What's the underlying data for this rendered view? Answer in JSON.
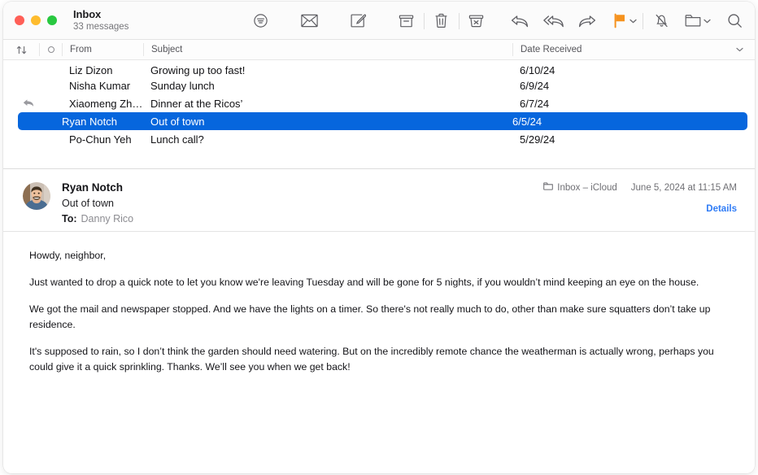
{
  "window": {
    "traffic_lights": [
      {
        "name": "close",
        "color": "#ff5f57"
      },
      {
        "name": "minimize",
        "color": "#febc2e"
      },
      {
        "name": "zoom",
        "color": "#28c840"
      }
    ]
  },
  "header": {
    "title": "Inbox",
    "subtitle": "33 messages"
  },
  "toolbar": {
    "items": [
      {
        "name": "filter-icon",
        "label": "Filter"
      },
      {
        "name": "mark-read-icon",
        "label": "Mark as Read"
      },
      {
        "name": "compose-icon",
        "label": "New Message"
      },
      {
        "name": "archive-icon",
        "label": "Archive"
      },
      {
        "name": "trash-icon",
        "label": "Delete"
      },
      {
        "name": "junk-icon",
        "label": "Move to Junk"
      },
      {
        "name": "reply-icon",
        "label": "Reply"
      },
      {
        "name": "reply-all-icon",
        "label": "Reply All"
      },
      {
        "name": "forward-icon",
        "label": "Forward"
      },
      {
        "name": "flag-icon",
        "label": "Flag"
      },
      {
        "name": "mute-icon",
        "label": "Mute"
      },
      {
        "name": "move-folder-icon",
        "label": "Move to Folder"
      },
      {
        "name": "search-icon",
        "label": "Search"
      }
    ],
    "flag_color": "#f5921e"
  },
  "list": {
    "columns": {
      "sort": "sort-icon",
      "unread": "unread-circle",
      "from": "From",
      "subject": "Subject",
      "date": "Date Received"
    },
    "rows": [
      {
        "from": "Liz Dizon",
        "subject": "Growing up too fast!",
        "date": "6/10/24",
        "replied": false,
        "selected": false
      },
      {
        "from": "Nisha Kumar",
        "subject": "Sunday lunch",
        "date": "6/9/24",
        "replied": false,
        "selected": false
      },
      {
        "from": "Xiaomeng Zh…",
        "subject": "Dinner at the Ricos’",
        "date": "6/7/24",
        "replied": true,
        "selected": false
      },
      {
        "from": "Ryan Notch",
        "subject": "Out of town",
        "date": "6/5/24",
        "replied": false,
        "selected": true
      },
      {
        "from": "Po-Chun Yeh",
        "subject": "Lunch call?",
        "date": "5/29/24",
        "replied": false,
        "selected": false
      }
    ],
    "selection_color": "#0666dd"
  },
  "message": {
    "sender": "Ryan Notch",
    "subject": "Out of town",
    "to_label": "To:",
    "to_value": "Danny Rico",
    "mailbox": "Inbox – iCloud",
    "date": "June 5, 2024 at 11:15 AM",
    "details_label": "Details",
    "details_color": "#2f7cf6",
    "body": {
      "p1": "Howdy, neighbor,",
      "p2": "Just wanted to drop a quick note to let you know we're leaving Tuesday and will be gone for 5 nights, if you wouldn’t mind keeping an eye on the house.",
      "p3": "We got the mail and newspaper stopped. And we have the lights on a timer. So there's not really much to do, other than make sure squatters don’t take up residence.",
      "p4": "It's supposed to rain, so I don’t think the garden should need watering. But on the incredibly remote chance the weatherman is actually wrong, perhaps you could give it a quick sprinkling. Thanks. We’ll see you when we get back!"
    }
  }
}
